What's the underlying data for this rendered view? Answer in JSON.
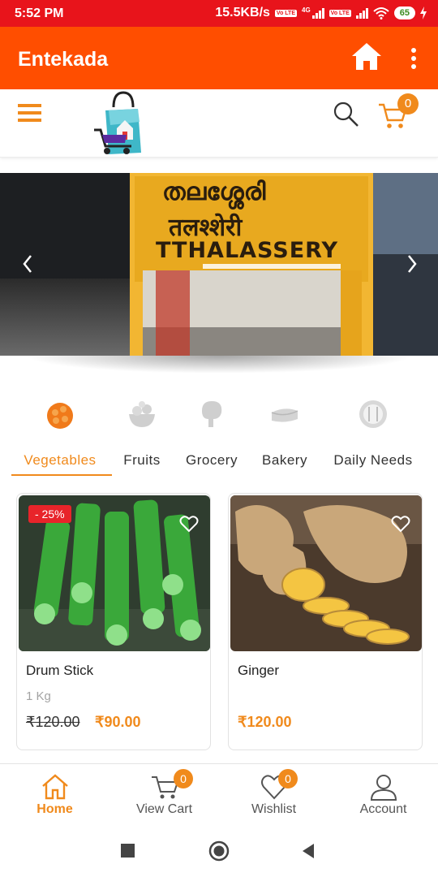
{
  "status_bar": {
    "time": "5:52 PM",
    "speed": "15.5KB/s",
    "volte1": "Vo LTE",
    "network": "4G",
    "volte2": "Vo LTE",
    "battery": "65"
  },
  "app_bar": {
    "title": "Entekada",
    "home_icon": "home-icon",
    "more_icon": "more-vert-icon"
  },
  "header": {
    "menu_icon": "hamburger-icon",
    "logo": "shopping-bag-logo",
    "search_icon": "search-icon",
    "cart_icon": "cart-icon",
    "cart_count": "0"
  },
  "banner": {
    "sign_line1": "തലശ്ശേരി",
    "sign_line2": "तलश्शेरी",
    "sign_line3": "TTHALASSERY",
    "prev_icon": "chevron-left-icon",
    "next_icon": "chevron-right-icon"
  },
  "categories": [
    {
      "label": "Vegetables",
      "icon": "vegetables-icon",
      "active": true
    },
    {
      "label": "Fruits",
      "icon": "fruits-icon",
      "active": false
    },
    {
      "label": "Grocery",
      "icon": "grocery-icon",
      "active": false
    },
    {
      "label": "Bakery",
      "icon": "bakery-icon",
      "active": false
    },
    {
      "label": "Daily Needs",
      "icon": "daily-needs-icon",
      "active": false
    }
  ],
  "products": [
    {
      "name": "Drum Stick",
      "unit": "1 Kg",
      "old_price": "₹120.00",
      "price": "₹90.00",
      "discount": "- 25%"
    },
    {
      "name": "Ginger",
      "unit": "",
      "old_price": "",
      "price": "₹120.00",
      "discount": ""
    }
  ],
  "bottom_nav": [
    {
      "label": "Home",
      "icon": "home-icon",
      "active": true
    },
    {
      "label": "View Cart",
      "icon": "cart-icon",
      "badge": "0"
    },
    {
      "label": "Wishlist",
      "icon": "heart-icon",
      "badge": "0"
    },
    {
      "label": "Account",
      "icon": "user-icon"
    }
  ],
  "colors": {
    "status_bar": "#e8141b",
    "app_bar": "#ff4e00",
    "accent": "#f08a1c",
    "discount": "#e8242a"
  }
}
